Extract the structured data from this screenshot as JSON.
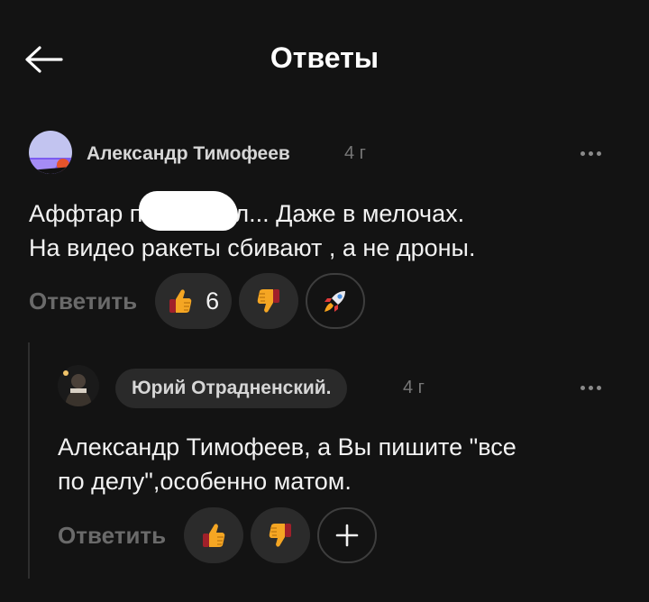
{
  "header": {
    "title": "Ответы",
    "back_icon": "arrow-left-icon"
  },
  "comments": [
    {
      "author": "Александр Тимофеев",
      "age": "4 г",
      "text_line1_before": "Аффтар п",
      "text_line1_after": "л... Даже в мелочах.",
      "text_line2": "На видео ракеты сбивают , а не дроны.",
      "reply_label": "Ответить",
      "likes": "6"
    },
    {
      "author": "Юрий Отрадненский.",
      "age": "4 г",
      "text_line1": "Александр Тимофеев, а Вы пишите \"все",
      "text_line2": "по делу\",особенно  матом.",
      "reply_label": "Ответить"
    }
  ],
  "colors": {
    "background": "#131313",
    "pill": "#2b2b2b",
    "muted_text": "#6a6a6a"
  }
}
